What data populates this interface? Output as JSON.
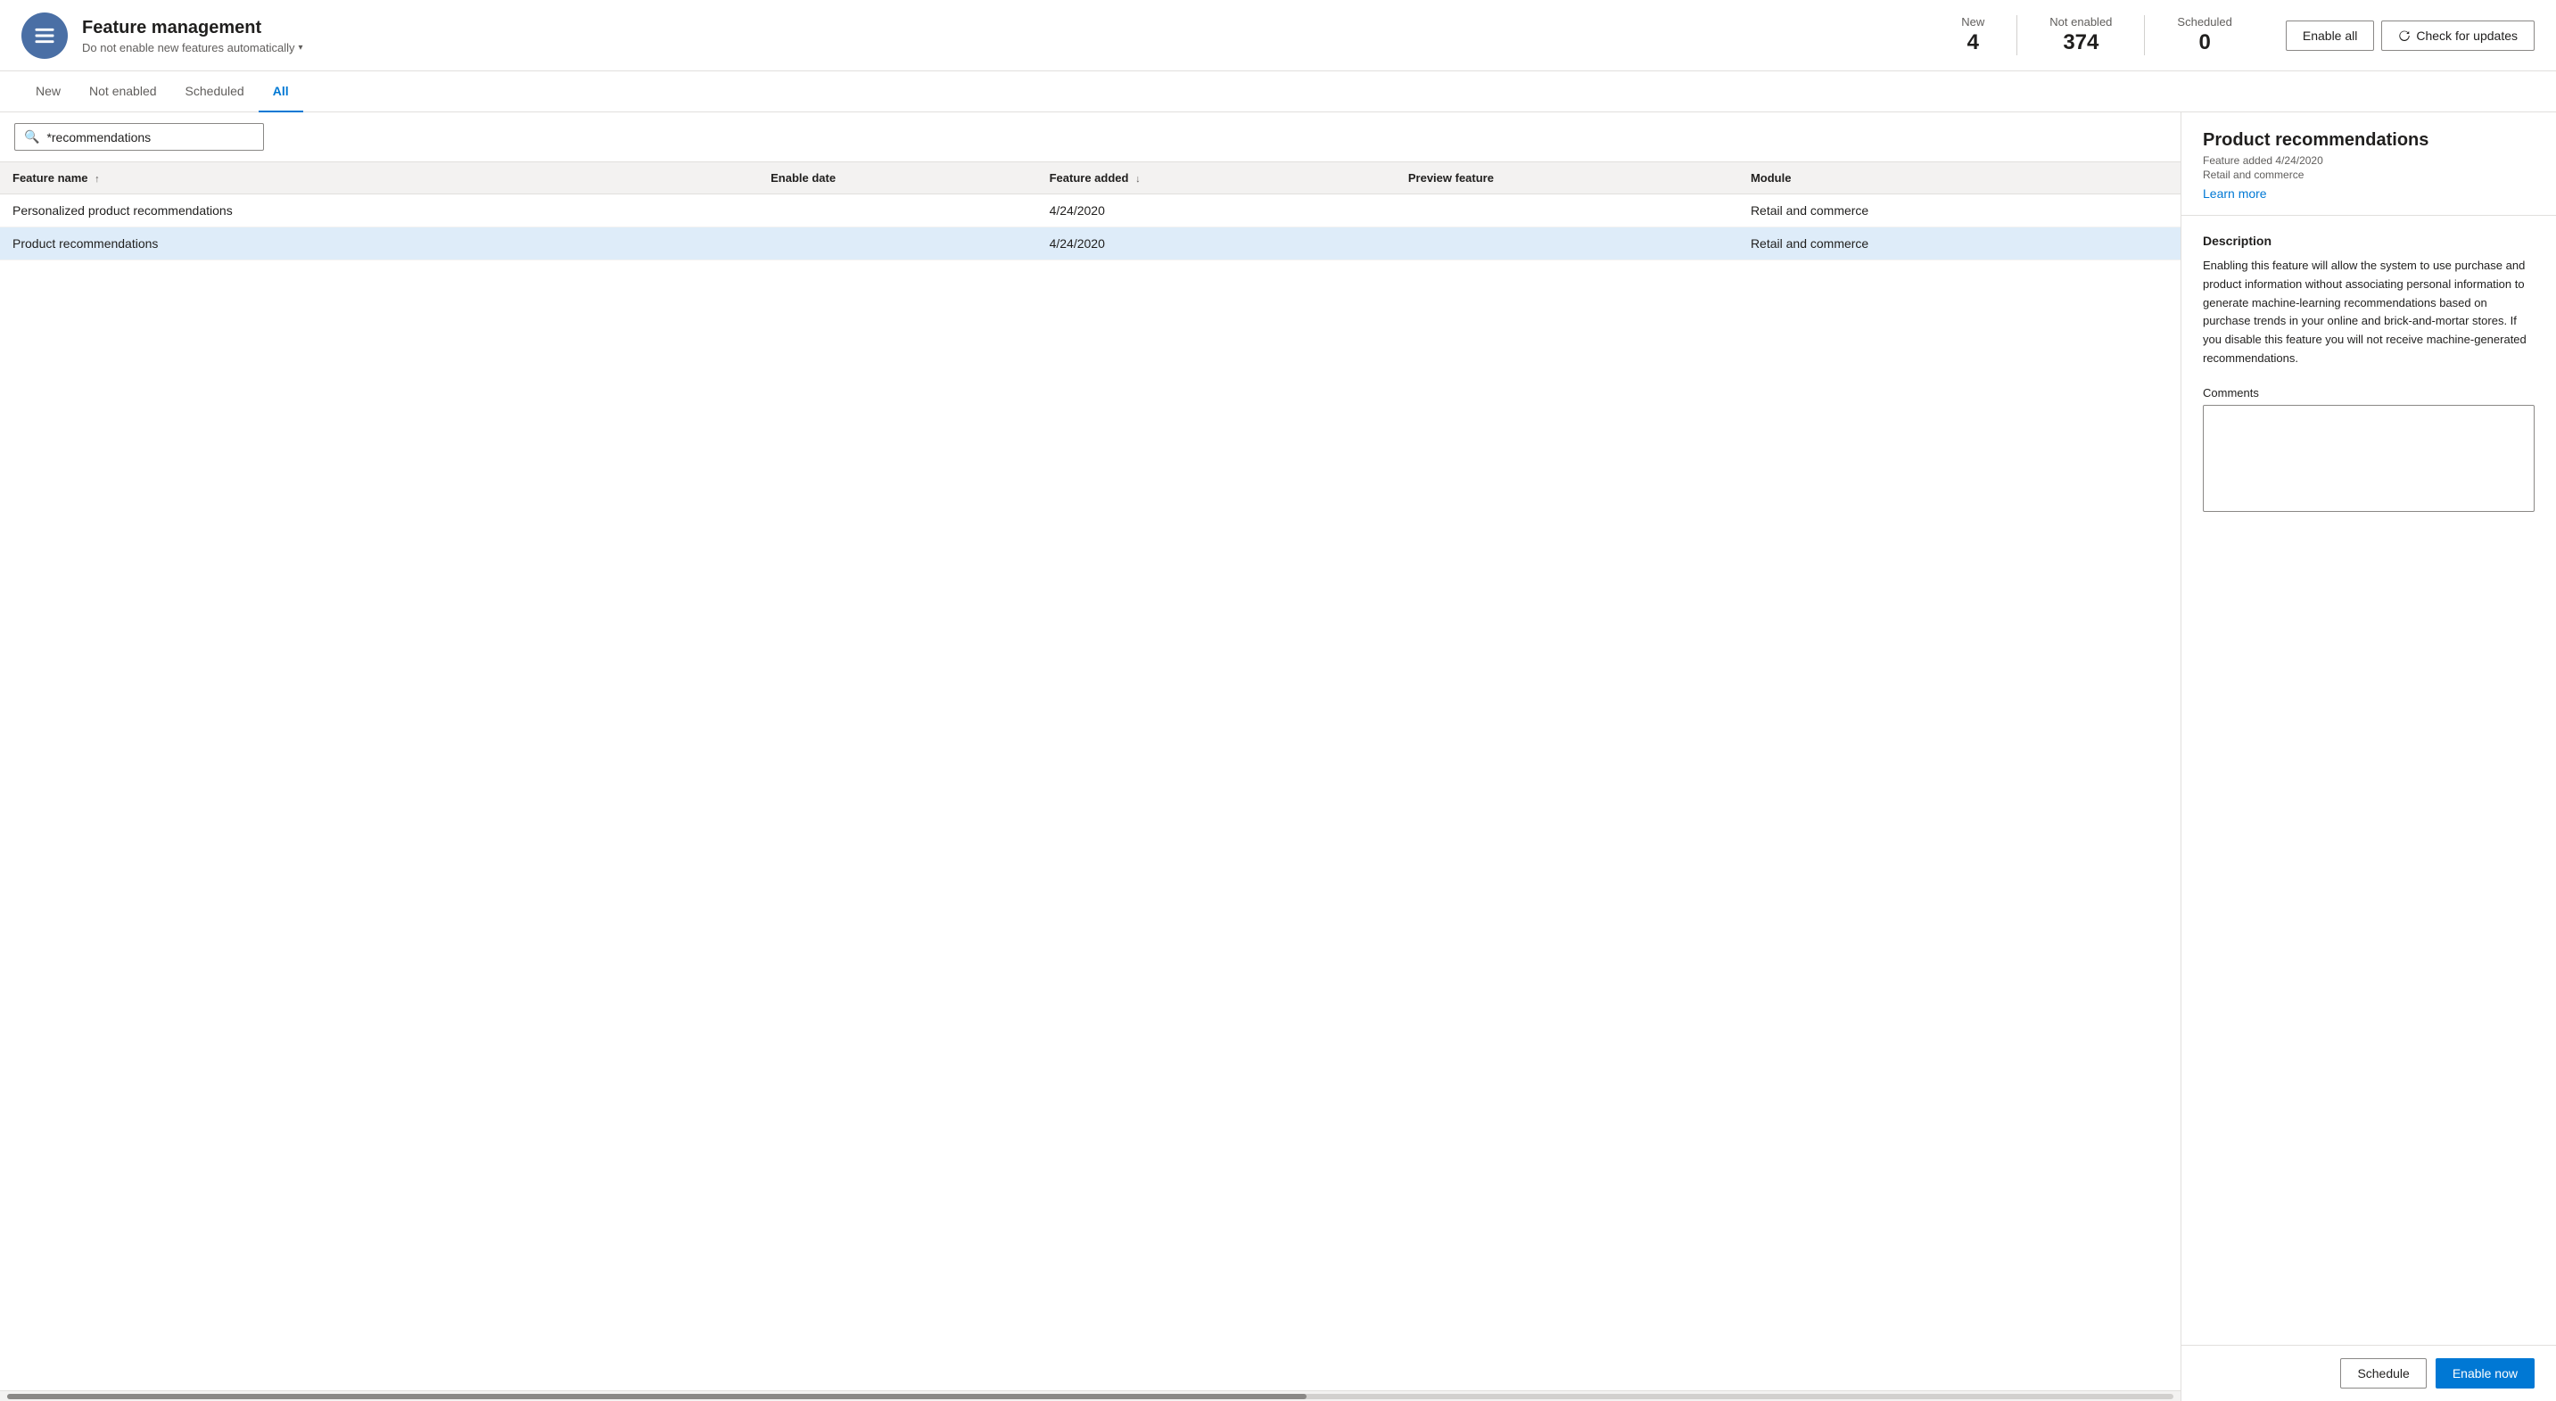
{
  "header": {
    "title": "Feature management",
    "subtitle": "Do not enable new features automatically",
    "app_icon_aria": "Feature management app icon",
    "stats": [
      {
        "label": "New",
        "value": "4"
      },
      {
        "label": "Not enabled",
        "value": "374"
      },
      {
        "label": "Scheduled",
        "value": "0"
      }
    ],
    "enable_all_label": "Enable all",
    "check_updates_label": "Check for updates"
  },
  "tabs": [
    {
      "id": "new",
      "label": "New"
    },
    {
      "id": "not-enabled",
      "label": "Not enabled"
    },
    {
      "id": "scheduled",
      "label": "Scheduled"
    },
    {
      "id": "all",
      "label": "All",
      "active": true
    }
  ],
  "table": {
    "search_value": "*recommendations",
    "search_placeholder": "Search",
    "columns": [
      {
        "id": "feature-name",
        "label": "Feature name",
        "sort": "asc"
      },
      {
        "id": "enable-date",
        "label": "Enable date"
      },
      {
        "id": "feature-added",
        "label": "Feature added",
        "sort": "desc"
      },
      {
        "id": "preview-feature",
        "label": "Preview feature"
      },
      {
        "id": "module",
        "label": "Module"
      }
    ],
    "rows": [
      {
        "id": "row-1",
        "feature_name": "Personalized product recommendations",
        "enable_date": "",
        "feature_added": "4/24/2020",
        "preview_feature": "",
        "module": "Retail and commerce",
        "selected": false
      },
      {
        "id": "row-2",
        "feature_name": "Product recommendations",
        "enable_date": "",
        "feature_added": "4/24/2020",
        "preview_feature": "",
        "module": "Retail and commerce",
        "selected": true
      }
    ]
  },
  "detail_panel": {
    "title": "Product recommendations",
    "feature_added_label": "Feature added 4/24/2020",
    "module_label": "Retail and commerce",
    "learn_more_label": "Learn more",
    "description_heading": "Description",
    "description_text": "Enabling this feature will allow the system to use purchase and product information without associating personal information to generate machine-learning recommendations based on purchase trends in your online and brick-and-mortar stores. If you disable this feature you will not receive machine-generated recommendations.",
    "comments_label": "Comments",
    "comments_value": "",
    "schedule_label": "Schedule",
    "enable_now_label": "Enable now"
  }
}
